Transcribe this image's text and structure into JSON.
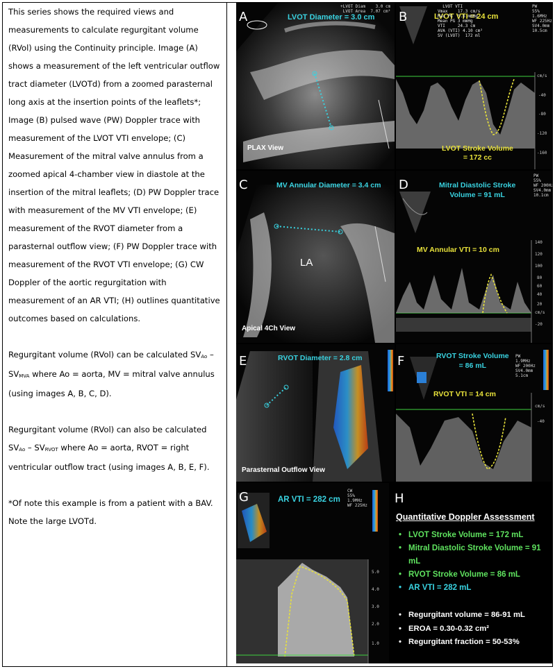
{
  "caption": {
    "para1": "This series shows the required views and measurements to calculate regurgitant volume (RVol) using the Continuity principle. Image (A) shows a measurement of the left ventricular outflow tract diameter (LVOTd) from a zoomed parasternal long axis at the insertion points of the leaflets*; Image (B) pulsed wave (PW) Doppler trace with measurement of the LVOT VTI envelope; (C) Measurement of the mitral valve annulus from a zoomed apical 4-chamber view in diastole at the insertion of the mitral leaflets; (D) PW Doppler trace with measurement of the MV VTI envelope; (E) measurement of the RVOT diameter from a parasternal outflow view; (F) PW Doppler trace with measurement of the RVOT VTI envelope; (G) CW Doppler of the aortic regurgitation with measurement of an AR VTI; (H) outlines quantitative outcomes based on calculations.",
    "para2_pre": "Regurgitant volume (RVol) can be calculated SV",
    "para2_sub1": "Ao",
    "para2_mid": " – SV",
    "para2_sub2": "MVA",
    "para2_post": " where Ao = aorta, MV = mitral valve annulus (using images A, B, C, D).",
    "para3_pre": "Regurgitant volume (RVol) can also be calculated SV",
    "para3_sub1": "Ao",
    "para3_mid": " – SV",
    "para3_sub2": "RVOT",
    "para3_post": " where Ao = aorta, RVOT = right ventricular outflow tract (using images A, B, E, F).",
    "para4": "*Of note this example is from a patient with a BAV. Note the large LVOTd."
  },
  "panels": {
    "A": {
      "letter": "A",
      "label": "LVOT Diameter = 3.0 cm",
      "view": "PLAX View",
      "info": "+LVOT Diam    3.0 cm\n LVOT Area  7.07 cm²"
    },
    "B": {
      "letter": "B",
      "label": "LVOT VTI = 24 cm",
      "sv": "LVOT Stroke Volume\n= 172 cc",
      "info": "  LVOT VTI\nVmax    17.3 cm/s\nMax PG  5.6 mmHg\nMean PG 3 mmHg\nVTI     24.3 cm\nAVA (VTI) 4.10 cm²\nSV (LVOT)  172 ml",
      "ticks": [
        "cm/s",
        "-40",
        "-80",
        "-120",
        "-160"
      ],
      "pw": "PW\n55%\n1.6MHz\nWF 225Hz\nSV4.0mm\n10.5cm"
    },
    "C": {
      "letter": "C",
      "label": "MV Annular Diameter = 3.4 cm",
      "chamber": "LA",
      "view": "Apical 4Ch View"
    },
    "D": {
      "letter": "D",
      "label": "Mitral Diastolic Stroke\nVolume = 91 mL",
      "vti": "MV Annular VTI = 10 cm",
      "ticks": [
        "140",
        "120",
        "100",
        "80",
        "60",
        "40",
        "20",
        "cm/s",
        "-20"
      ],
      "pw": "PW\n55%\nWF 200Hz\nSV4.0mm\n10.1cm"
    },
    "E": {
      "letter": "E",
      "label": "RVOT Diameter = 2.8 cm",
      "view": "Parasternal Outflow View"
    },
    "F": {
      "letter": "F",
      "label": "RVOT Stroke Volume\n= 86 mL",
      "vti": "RVOT VTI = 14 cm",
      "ticks": [
        "cm/s",
        "-40"
      ],
      "pw": "PW\n1.9MHz\nWF 200Hz\nSV4.0mm\n5.1cm"
    },
    "G": {
      "letter": "G",
      "label": "AR VTI = 282 cm",
      "ticks": [
        "5.0",
        "4.0",
        "3.0",
        "2.0",
        "1.0"
      ],
      "cw": "CW\n55%\n1.9MHz\nWF 225Hz"
    },
    "H": {
      "letter": "H",
      "title": "Quantitative Doppler Assessment",
      "items": [
        "LVOT Stroke Volume = 172 mL",
        "Mitral Diastolic Stroke Volume = 91 mL",
        "RVOT Stroke Volume =  86 mL",
        "AR VTI = 282 mL"
      ],
      "results": [
        "Regurgitant volume = 86-91 mL",
        "EROA = 0.30-0.32 cm²",
        "Regurgitant fraction = 50-53%"
      ]
    }
  },
  "colors": {
    "cyan": "#39d2e0",
    "yellow": "#e8e23a",
    "green": "#5fe35f",
    "white": "#ffffff"
  }
}
